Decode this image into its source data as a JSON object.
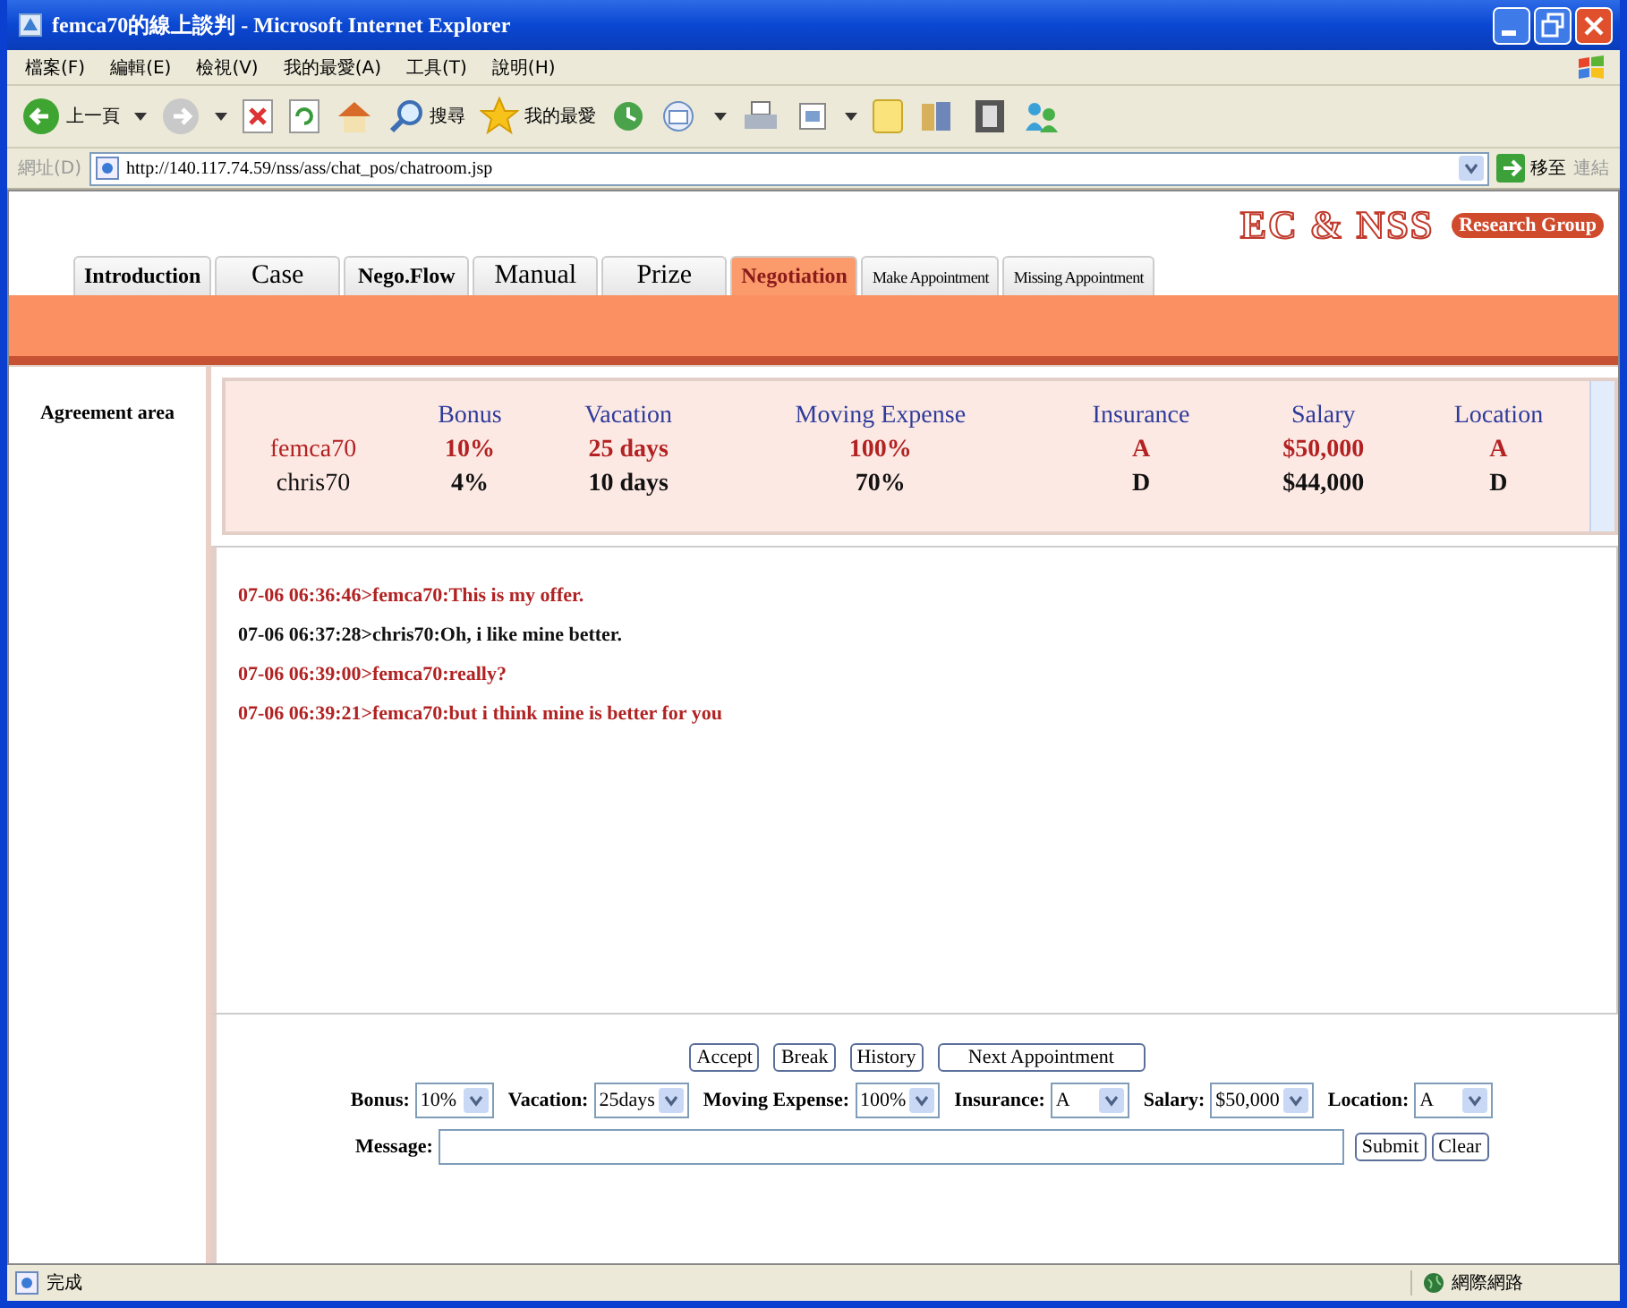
{
  "window": {
    "title": "femca70的線上談判 - Microsoft Internet Explorer"
  },
  "menu": [
    "檔案(F)",
    "編輯(E)",
    "檢視(V)",
    "我的最愛(A)",
    "工具(T)",
    "說明(H)"
  ],
  "toolbar": {
    "back": "上一頁",
    "search": "搜尋",
    "favorites": "我的最愛"
  },
  "address": {
    "label": "網址(D)",
    "value": "http://140.117.74.59/nss/ass/chat_pos/chatroom.jsp",
    "go": "移至",
    "links": "連結"
  },
  "logo": {
    "title": "EC & NSS",
    "subtitle": "Research Group"
  },
  "tabs": [
    {
      "label": "Introduction",
      "selected": false,
      "kind": "normal"
    },
    {
      "label": "Case",
      "selected": false,
      "kind": "large"
    },
    {
      "label": "Nego.Flow",
      "selected": false,
      "kind": "normal"
    },
    {
      "label": "Manual",
      "selected": false,
      "kind": "large"
    },
    {
      "label": "Prize",
      "selected": false,
      "kind": "large"
    },
    {
      "label": "Negotiation",
      "selected": true,
      "kind": "normal"
    },
    {
      "label": "Make Appointment",
      "selected": false,
      "kind": "small"
    },
    {
      "label": "Missing Appointment",
      "selected": false,
      "kind": "small"
    }
  ],
  "sidebar": {
    "label": "Agreement area"
  },
  "agreement": {
    "columns": [
      "Bonus",
      "Vacation",
      "Moving Expense",
      "Insurance",
      "Salary",
      "Location"
    ],
    "rows": [
      {
        "name": "femca70",
        "color": "#b22222",
        "values": [
          "10%",
          "25 days",
          "100%",
          "A",
          "$50,000",
          "A"
        ]
      },
      {
        "name": "chris70",
        "color": "#111111",
        "values": [
          "4%",
          "10 days",
          "70%",
          "D",
          "$44,000",
          "D"
        ]
      }
    ]
  },
  "messages": [
    {
      "text": "07-06 06:36:46>femca70:This is my offer.",
      "color": "#b22222"
    },
    {
      "text": "07-06 06:37:28>chris70:Oh, i like mine better.",
      "color": "#111111"
    },
    {
      "text": "07-06 06:39:00>femca70:really?",
      "color": "#b22222"
    },
    {
      "text": "07-06 06:39:21>femca70:but i think mine is better for you",
      "color": "#b22222"
    }
  ],
  "actions": [
    "Accept",
    "Break",
    "History",
    "Next Appointment"
  ],
  "offer": [
    {
      "label": "Bonus:",
      "value": "10%"
    },
    {
      "label": "Vacation:",
      "value": "25days"
    },
    {
      "label": "Moving Expense:",
      "value": "100%"
    },
    {
      "label": "Insurance:",
      "value": "A"
    },
    {
      "label": "Salary:",
      "value": "$50,000"
    },
    {
      "label": "Location:",
      "value": "A"
    }
  ],
  "message_form": {
    "label": "Message:",
    "buttons": [
      "Submit",
      "Clear"
    ]
  },
  "status_bar": {
    "text": "完成",
    "zone": "網際網路"
  }
}
